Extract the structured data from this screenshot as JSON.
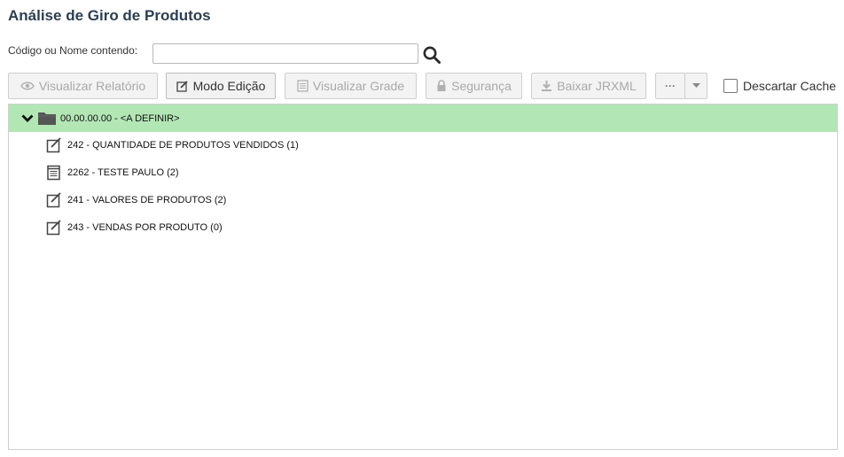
{
  "page": {
    "title": "Análise de Giro de Produtos"
  },
  "search": {
    "label": "Código ou Nome contendo:",
    "value": "",
    "placeholder": ""
  },
  "toolbar": {
    "view_report": "Visualizar Relatório",
    "edit_mode": "Modo Edição",
    "view_grid": "Visualizar Grade",
    "security": "Segurança",
    "download_jrxml": "Baixar JRXML",
    "more": "···",
    "discard_cache_label": "Descartar Cache"
  },
  "tree": {
    "root": {
      "label": "00.00.00.00 - <A DEFINIR>",
      "expanded": true,
      "highlight_color": "#b3e6b5"
    },
    "items": [
      {
        "label": "242 - QUANTIDADE DE PRODUTOS VENDIDOS (1)",
        "icon": "edit-doc-icon"
      },
      {
        "label": "2262 - TESTE PAULO (2)",
        "icon": "grid-doc-icon"
      },
      {
        "label": "241 - VALORES DE PRODUTOS (2)",
        "icon": "edit-doc-icon"
      },
      {
        "label": "243 - VENDAS POR PRODUTO (0)",
        "icon": "edit-doc-icon"
      }
    ]
  }
}
